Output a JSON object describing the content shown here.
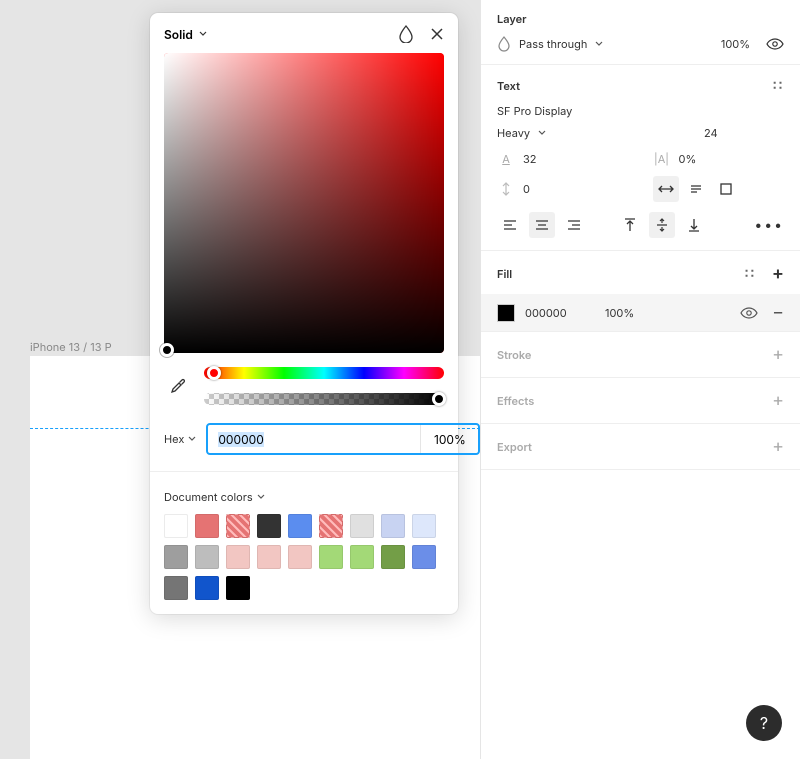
{
  "canvas": {
    "frame_label": "iPhone 13 / 13 P"
  },
  "color_picker": {
    "mode_label": "Solid",
    "hex_label": "Hex",
    "hex_value": "000000",
    "opacity_value": "100%",
    "doc_colors_label": "Document colors",
    "swatches": [
      {
        "hex": "#FFFFFF"
      },
      {
        "hex": "#E57373"
      },
      {
        "hex": "#E57373",
        "missing": true
      },
      {
        "hex": "#333333"
      },
      {
        "hex": "#5B8DEF"
      },
      {
        "hex": "#E57373",
        "missing": true
      },
      {
        "hex": "#E0E0E0"
      },
      {
        "hex": "#C8D3F2"
      },
      {
        "hex": "#DDE7FB"
      },
      {
        "hex": "#9E9E9E"
      },
      {
        "hex": "#BDBDBD"
      },
      {
        "hex": "#F2C6C2"
      },
      {
        "hex": "#F2C6C2"
      },
      {
        "hex": "#F2C6C2"
      },
      {
        "hex": "#A3D977"
      },
      {
        "hex": "#A3D977"
      },
      {
        "hex": "#739E47"
      },
      {
        "hex": "#6B8EE8"
      },
      {
        "hex": "#757575"
      },
      {
        "hex": "#1155CC"
      },
      {
        "hex": "#000000"
      }
    ]
  },
  "panel": {
    "layer": {
      "title": "Layer",
      "blend_mode": "Pass through",
      "opacity": "100%"
    },
    "text": {
      "title": "Text",
      "font_family": "SF Pro Display",
      "font_weight": "Heavy",
      "font_size": "24",
      "line_height": "32",
      "letter_spacing": "0%",
      "paragraph_spacing": "0"
    },
    "fill": {
      "title": "Fill",
      "hex": "000000",
      "opacity": "100%"
    },
    "stroke_title": "Stroke",
    "effects_title": "Effects",
    "export_title": "Export"
  },
  "help_label": "?"
}
